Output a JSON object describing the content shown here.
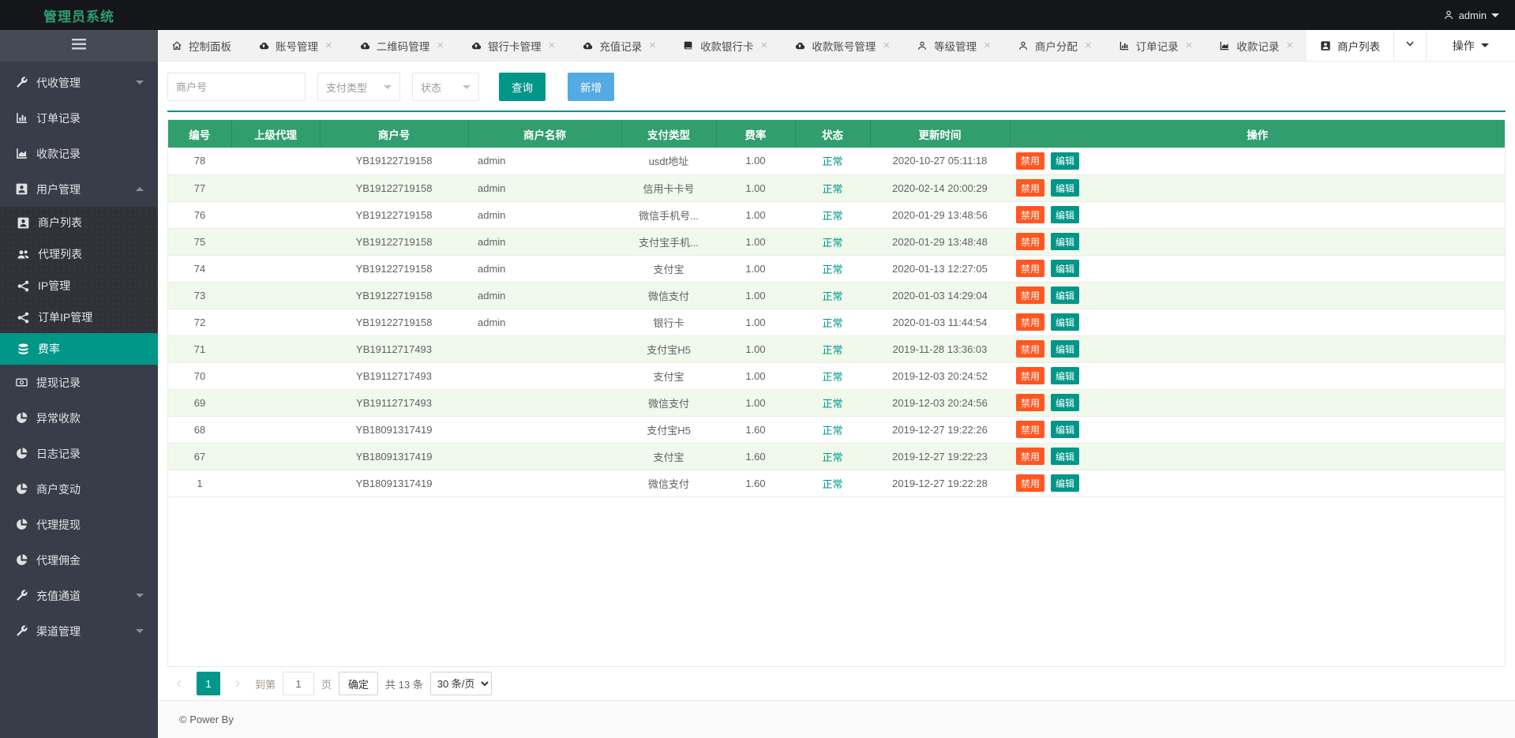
{
  "header": {
    "title": "管理员系统",
    "user": "admin"
  },
  "sidebar": {
    "items": [
      {
        "label": "代收管理",
        "icon": "wrench-icon",
        "caret": "down"
      },
      {
        "label": "订单记录",
        "icon": "bar-chart-icon"
      },
      {
        "label": "收款记录",
        "icon": "area-chart-icon"
      },
      {
        "label": "用户管理",
        "icon": "user-icon",
        "caret": "up",
        "expanded": true,
        "children": [
          {
            "label": "商户列表",
            "icon": "user-icon"
          },
          {
            "label": "代理列表",
            "icon": "users-icon"
          },
          {
            "label": "IP管理",
            "icon": "share-icon"
          },
          {
            "label": "订单IP管理",
            "icon": "share-icon"
          },
          {
            "label": "费率",
            "icon": "database-icon",
            "active": true
          }
        ]
      },
      {
        "label": "提现记录",
        "icon": "money-icon"
      },
      {
        "label": "异常收款",
        "icon": "pie-chart-icon"
      },
      {
        "label": "日志记录",
        "icon": "pie-chart-icon"
      },
      {
        "label": "商户变动",
        "icon": "pie-chart-icon"
      },
      {
        "label": "代理提现",
        "icon": "pie-chart-icon"
      },
      {
        "label": "代理佣金",
        "icon": "pie-chart-icon"
      },
      {
        "label": "充值通道",
        "icon": "wrench-icon",
        "caret": "down"
      },
      {
        "label": "渠道管理",
        "icon": "wrench-icon",
        "caret": "down"
      }
    ]
  },
  "tabbar": {
    "tabs": [
      {
        "label": "控制面板",
        "icon": "home-icon",
        "closable": false
      },
      {
        "label": "账号管理",
        "icon": "cloud-icon",
        "closable": true
      },
      {
        "label": "二维码管理",
        "icon": "cloud-icon",
        "closable": true
      },
      {
        "label": "银行卡管理",
        "icon": "cloud-icon",
        "closable": true
      },
      {
        "label": "充值记录",
        "icon": "cloud-icon",
        "closable": true
      },
      {
        "label": "收款银行卡",
        "icon": "book-icon",
        "closable": true
      },
      {
        "label": "收款账号管理",
        "icon": "cloud-icon",
        "closable": true
      },
      {
        "label": "等级管理",
        "icon": "person-icon",
        "closable": true
      },
      {
        "label": "商户分配",
        "icon": "person-icon",
        "closable": true
      },
      {
        "label": "订单记录",
        "icon": "bar-chart-icon",
        "closable": true
      },
      {
        "label": "收款记录",
        "icon": "area-chart-icon",
        "closable": true
      },
      {
        "label": "商户列表",
        "icon": "user-icon",
        "closable": false,
        "active": true
      }
    ],
    "ops_label": "操作"
  },
  "filters": {
    "merchant_placeholder": "商户号",
    "pay_type_placeholder": "支付类型",
    "status_placeholder": "状态",
    "search_label": "查询",
    "add_label": "新增"
  },
  "table": {
    "columns": [
      "编号",
      "上级代理",
      "商户号",
      "商户名称",
      "支付类型",
      "费率",
      "状态",
      "更新时间",
      "操作"
    ],
    "status_normal": "正常",
    "disable_label": "禁用",
    "edit_label": "编辑",
    "rows": [
      {
        "id": "78",
        "agent": "",
        "merchant_no": "YB19122719158",
        "merchant_name": "admin",
        "pay_type": "usdt地址",
        "rate": "1.00",
        "status": "正常",
        "updated": "2020-10-27 05:11:18"
      },
      {
        "id": "77",
        "agent": "",
        "merchant_no": "YB19122719158",
        "merchant_name": "admin",
        "pay_type": "信用卡卡号",
        "rate": "1.00",
        "status": "正常",
        "updated": "2020-02-14 20:00:29"
      },
      {
        "id": "76",
        "agent": "",
        "merchant_no": "YB19122719158",
        "merchant_name": "admin",
        "pay_type": "微信手机号...",
        "rate": "1.00",
        "status": "正常",
        "updated": "2020-01-29 13:48:56"
      },
      {
        "id": "75",
        "agent": "",
        "merchant_no": "YB19122719158",
        "merchant_name": "admin",
        "pay_type": "支付宝手机...",
        "rate": "1.00",
        "status": "正常",
        "updated": "2020-01-29 13:48:48"
      },
      {
        "id": "74",
        "agent": "",
        "merchant_no": "YB19122719158",
        "merchant_name": "admin",
        "pay_type": "支付宝",
        "rate": "1.00",
        "status": "正常",
        "updated": "2020-01-13 12:27:05"
      },
      {
        "id": "73",
        "agent": "",
        "merchant_no": "YB19122719158",
        "merchant_name": "admin",
        "pay_type": "微信支付",
        "rate": "1.00",
        "status": "正常",
        "updated": "2020-01-03 14:29:04"
      },
      {
        "id": "72",
        "agent": "",
        "merchant_no": "YB19122719158",
        "merchant_name": "admin",
        "pay_type": "银行卡",
        "rate": "1.00",
        "status": "正常",
        "updated": "2020-01-03 11:44:54"
      },
      {
        "id": "71",
        "agent": "",
        "merchant_no": "YB19112717493",
        "merchant_name": "",
        "pay_type": "支付宝H5",
        "rate": "1.00",
        "status": "正常",
        "updated": "2019-11-28 13:36:03"
      },
      {
        "id": "70",
        "agent": "",
        "merchant_no": "YB19112717493",
        "merchant_name": "",
        "pay_type": "支付宝",
        "rate": "1.00",
        "status": "正常",
        "updated": "2019-12-03 20:24:52"
      },
      {
        "id": "69",
        "agent": "",
        "merchant_no": "YB19112717493",
        "merchant_name": "",
        "pay_type": "微信支付",
        "rate": "1.00",
        "status": "正常",
        "updated": "2019-12-03 20:24:56"
      },
      {
        "id": "68",
        "agent": "",
        "merchant_no": "YB18091317419",
        "merchant_name": "",
        "pay_type": "支付宝H5",
        "rate": "1.60",
        "status": "正常",
        "updated": "2019-12-27 19:22:26"
      },
      {
        "id": "67",
        "agent": "",
        "merchant_no": "YB18091317419",
        "merchant_name": "",
        "pay_type": "支付宝",
        "rate": "1.60",
        "status": "正常",
        "updated": "2019-12-27 19:22:23"
      },
      {
        "id": "1",
        "agent": "",
        "merchant_no": "YB18091317419",
        "merchant_name": "",
        "pay_type": "微信支付",
        "rate": "1.60",
        "status": "正常",
        "updated": "2019-12-27 19:22:28"
      }
    ]
  },
  "pagination": {
    "current_page": "1",
    "goto_label": "到第",
    "goto_value": "1",
    "page_label": "页",
    "confirm_label": "确定",
    "total_label": "共 13 条",
    "page_size": "30 条/页"
  },
  "footer": {
    "text": "© Power By"
  },
  "colors": {
    "accent_teal": "#009688",
    "table_header_green": "#319e6d",
    "danger_orange": "#ff5722",
    "add_button_blue": "#54abe4",
    "stripe_green": "#f0f9eb",
    "sidebar_dark": "#393d49",
    "topbar_dark": "#15161a",
    "logo_green": "#2e9c72"
  }
}
